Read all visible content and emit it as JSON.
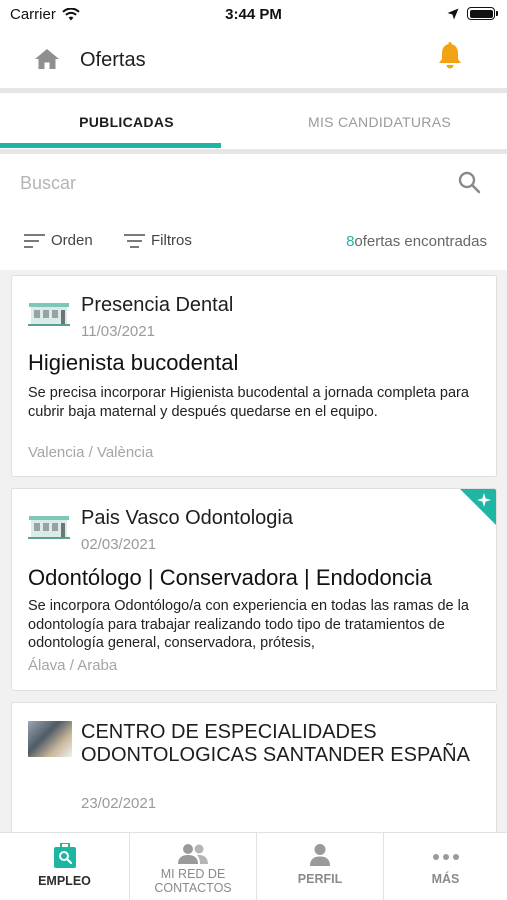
{
  "status_bar": {
    "carrier": "Carrier",
    "time": "3:44 PM"
  },
  "header": {
    "title": "Ofertas",
    "home_icon": "home-icon",
    "bell_icon": "bell-icon",
    "accent": "#f2a313"
  },
  "tabs": [
    {
      "label": "PUBLICADAS",
      "active": true
    },
    {
      "label": "MIS CANDIDATURAS",
      "active": false
    }
  ],
  "accent_color": "#1fb5a3",
  "search": {
    "placeholder": "Buscar",
    "value": ""
  },
  "filters": {
    "order_label": "Orden",
    "filters_label": "Filtros",
    "results_count": "8",
    "results_text": "ofertas encontradas"
  },
  "offers": [
    {
      "company": "Presencia Dental",
      "date": "11/03/2021",
      "title": "Higienista bucodental",
      "description": "Se precisa incorporar Higienista bucodental a jornada completa para cubrir baja maternal y después quedarse en el equipo.",
      "location": "Valencia / València",
      "featured": false
    },
    {
      "company": "Pais Vasco Odontologia",
      "date": "02/03/2021",
      "title": "Odontólogo | Conservadora | Endodoncia",
      "description": "Se incorpora Odontólogo/a con experiencia en todas las ramas de la odontología para trabajar realizando todo tipo de tratamientos de odontología general, conservadora, prótesis,",
      "location": "Álava / Araba",
      "featured": true
    },
    {
      "company": "CENTRO DE ESPECIALIDADES ODONTOLOGICAS SANTANDER ESPAÑA",
      "date": "23/02/2021",
      "title": "",
      "description": "",
      "location": "",
      "featured": false
    }
  ],
  "tab_bar": [
    {
      "label": "EMPLEO",
      "icon": "job-search-icon",
      "active": true
    },
    {
      "label": "MI RED DE CONTACTOS",
      "icon": "contacts-icon",
      "active": false
    },
    {
      "label": "PERFIL",
      "icon": "profile-icon",
      "active": false
    },
    {
      "label": "MÁS",
      "icon": "more-icon",
      "active": false
    }
  ]
}
